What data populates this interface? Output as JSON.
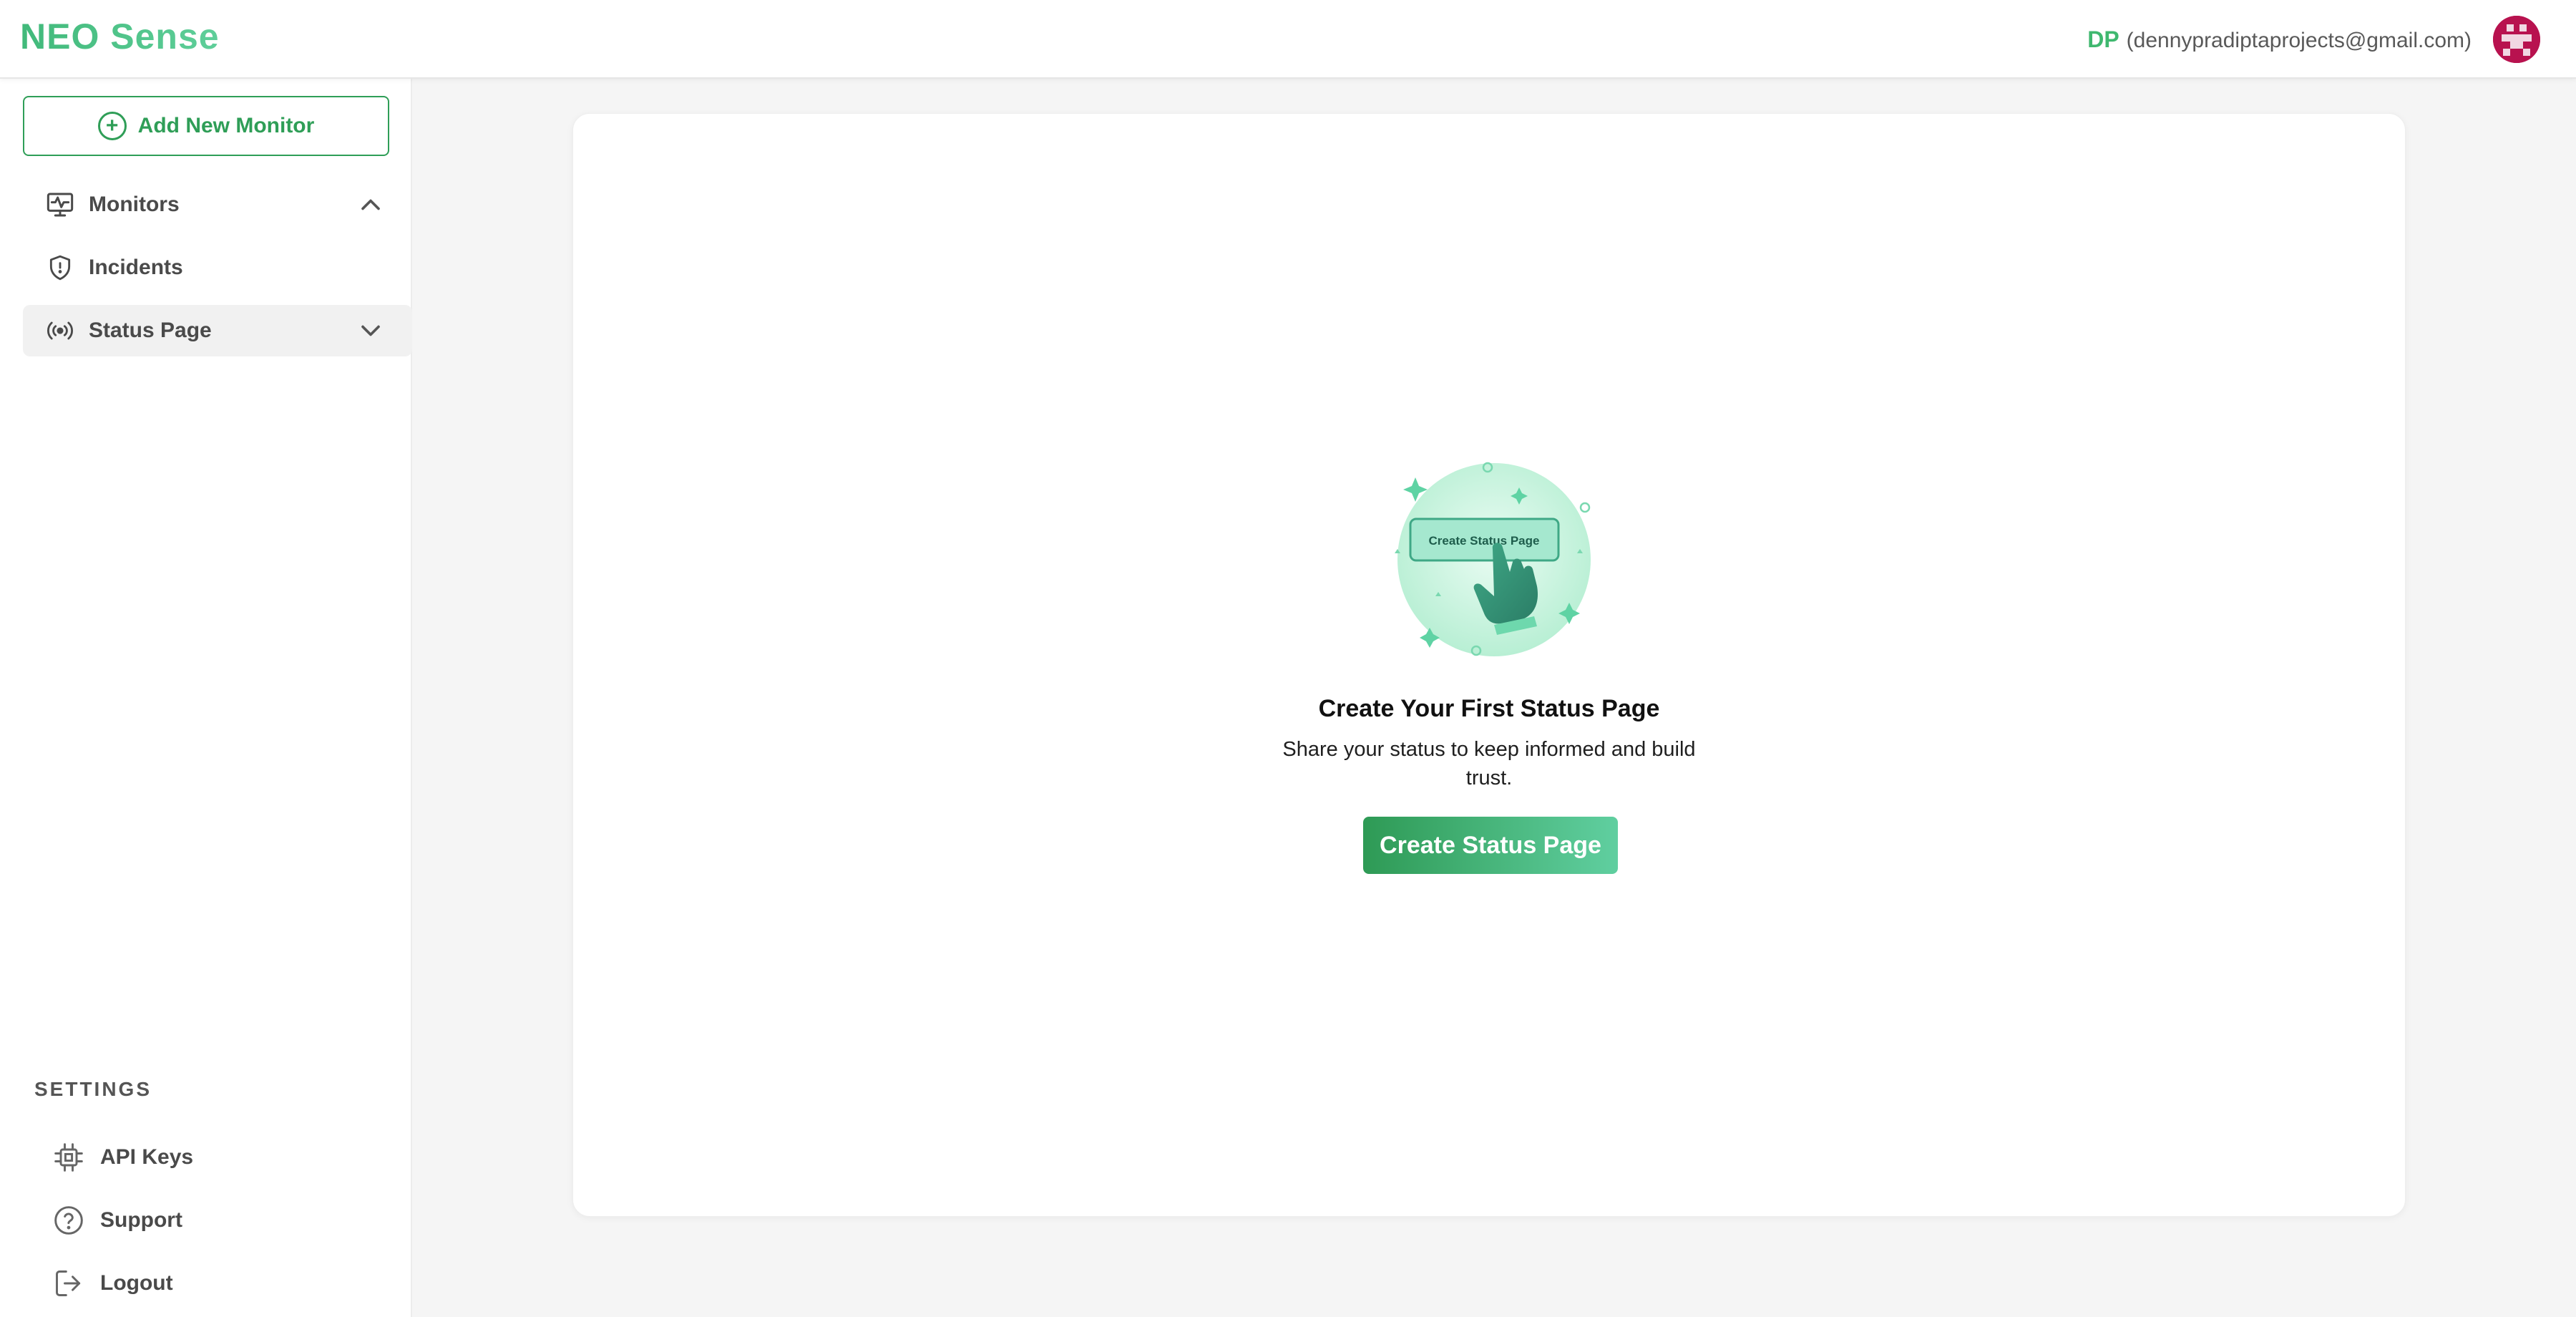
{
  "header": {
    "brand": "NEO Sense",
    "user_initials": "DP",
    "user_email": "(dennypradiptaprojects@gmail.com)",
    "avatar_icon": "identicon-avatar"
  },
  "sidebar": {
    "add_button_label": "Add New Monitor",
    "items": [
      {
        "label": "Monitors",
        "icon": "monitor-icon",
        "chevron": "chevron-up-icon"
      },
      {
        "label": "Incidents",
        "icon": "shield-icon"
      },
      {
        "label": "Status Page",
        "icon": "broadcast-icon",
        "chevron": "chevron-down-icon",
        "active": true
      }
    ],
    "settings_title": "SETTINGS",
    "settings_items": [
      {
        "label": "API Keys",
        "icon": "chip-icon"
      },
      {
        "label": "Support",
        "icon": "help-circle-icon"
      },
      {
        "label": "Logout",
        "icon": "logout-icon"
      }
    ]
  },
  "main": {
    "illustration_button_text": "Create Status Page",
    "title": "Create Your First Status Page",
    "subtitle": "Share your status to keep informed and build trust.",
    "cta_label": "Create Status Page"
  },
  "colors": {
    "accent": "#2f9e57",
    "accent_light": "#60cfa0",
    "brand_gradient_start": "#41b97a",
    "avatar": "#b8124f"
  }
}
